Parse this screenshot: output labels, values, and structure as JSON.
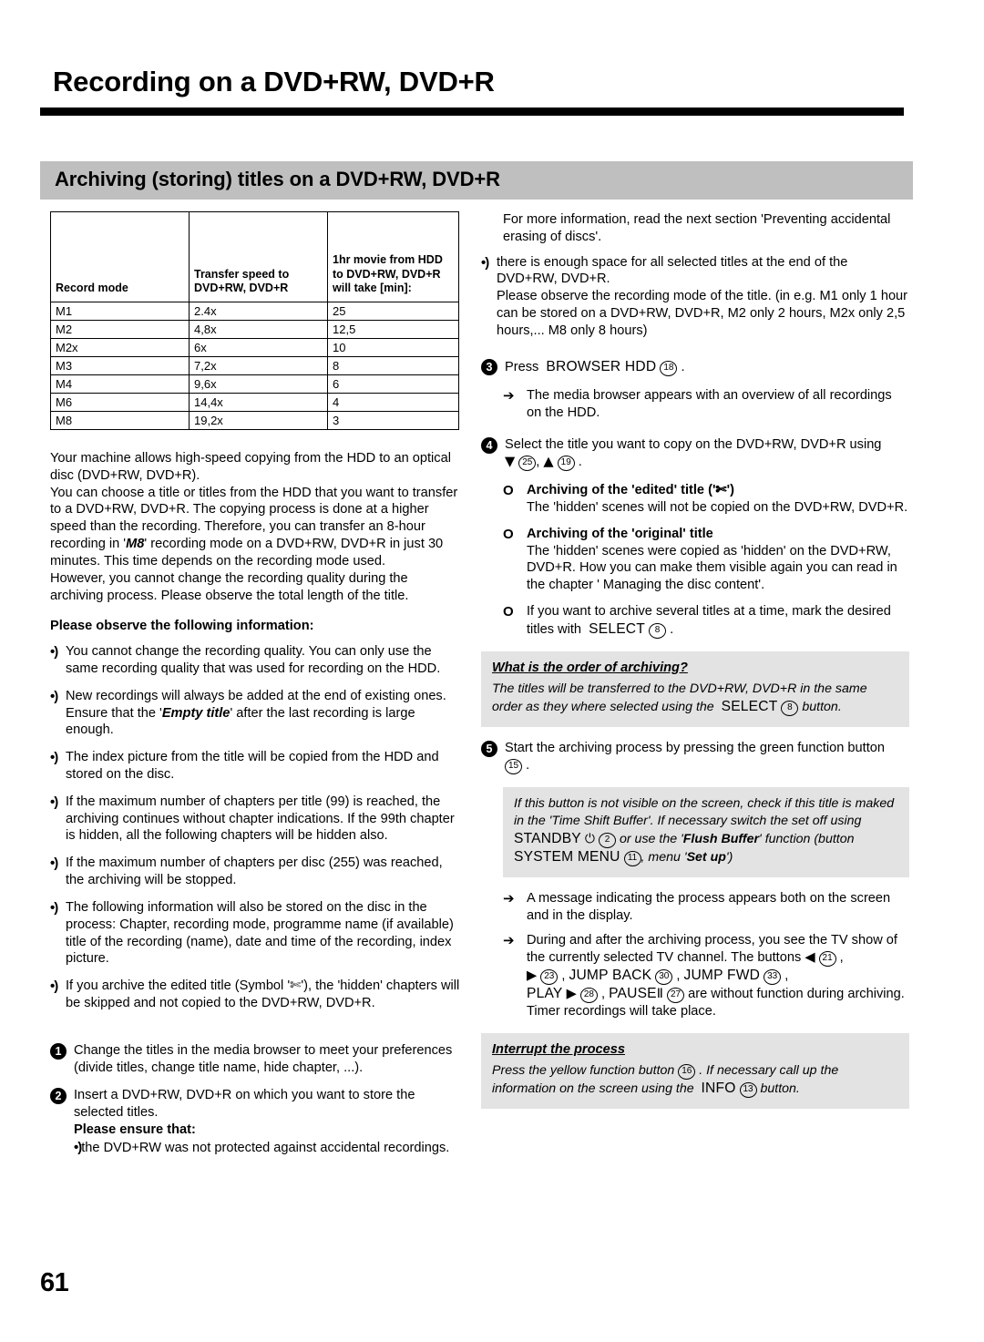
{
  "chapter": {
    "title": "Recording on a DVD+RW, DVD+R"
  },
  "section": {
    "title": "Archiving (storing) titles on a DVD+RW, DVD+R"
  },
  "table": {
    "headers": [
      "Record mode",
      "Transfer speed to DVD+RW, DVD+R",
      "1hr movie from HDD to DVD+RW, DVD+R will take [min]:"
    ],
    "rows": [
      [
        "M1",
        "2.4x",
        "25"
      ],
      [
        "M2",
        "4,8x",
        "12,5"
      ],
      [
        "M2x",
        "6x",
        "10"
      ],
      [
        "M3",
        "7,2x",
        "8"
      ],
      [
        "M4",
        "9,6x",
        "6"
      ],
      [
        "M6",
        "14,4x",
        "4"
      ],
      [
        "M8",
        "19,2x",
        "3"
      ]
    ]
  },
  "left_column": {
    "intro_p1": "Your machine allows high-speed copying from the HDD to an optical disc (DVD+RW, DVD+R).",
    "intro_p2_a": "You can choose a title or titles from the HDD that you want to transfer to a DVD+RW, DVD+R. The copying process is done at a higher speed than the recording. Therefore, you can transfer an 8-hour recording in '",
    "intro_p2_em": "M8",
    "intro_p2_b": "' recording mode on a DVD+RW, DVD+R in just 30 minutes. This time depends on the recording mode used.",
    "intro_p3": "However, you cannot change the recording quality during the archiving process. Please observe the total length of the title.",
    "observe_heading": "Please observe the following information:",
    "bullet_mark": "•)",
    "bullets": [
      {
        "text_a": "You cannot change the recording quality. You can only use the same recording quality that was used for recording on the HDD.",
        "em": "",
        "text_b": ""
      },
      {
        "text_a": "New recordings will always be added at the end of existing ones. Ensure that the '",
        "em": "Empty title",
        "text_b": "' after the last recording is large enough."
      },
      {
        "text_a": "The index picture from the title will be copied from the HDD and stored on the disc.",
        "em": "",
        "text_b": ""
      },
      {
        "text_a": "If the maximum number of chapters per title (99) is reached, the archiving continues without chapter indications. If the 99th chapter is hidden, all the following chapters will be hidden also.",
        "em": "",
        "text_b": ""
      },
      {
        "text_a": "If the maximum number of chapters per disc (255) was reached, the archiving will be stopped.",
        "em": "",
        "text_b": ""
      },
      {
        "text_a": "The following information will also be stored on the disc in the process: Chapter, recording mode, programme name (if available) title of the recording (name), date and time of the recording, index picture.",
        "em": "",
        "text_b": ""
      },
      {
        "text_a": "If you archive the edited title (Symbol '✄'), the 'hidden' chapters will be skipped and not copied to the DVD+RW, DVD+R.",
        "em": "",
        "text_b": ""
      }
    ],
    "step1": {
      "number": "1",
      "text": "Change the titles in the media browser to meet your preferences (divide titles, change title name, hide chapter, ...)."
    },
    "step2": {
      "number": "2",
      "text": "Insert a DVD+RW, DVD+R on which you want to store the selected titles.",
      "ensure_heading": "Please ensure that:",
      "ensure_bullet": "the DVD+RW was not protected against accidental recordings."
    }
  },
  "right_column": {
    "bullet_mark": "•)",
    "arrow_mark": "➔",
    "o_mark": "O",
    "intro": "For more information, read the next section 'Preventing accidental erasing of discs'.",
    "space_bullet": {
      "line1": "there is enough space for all selected titles at the end of the DVD+RW, DVD+R.",
      "line2": "Please observe the recording mode of the title. (in e.g. M1 only 1 hour can be stored on a DVD+RW, DVD+R, M2 only 2 hours, M2x only 2,5 hours,... M8 only 8 hours)"
    },
    "step3": {
      "number": "3",
      "press_label": "Press",
      "key": "BROWSER HDD",
      "key_ref": "18",
      "period": ".",
      "result": "The media browser appears with an overview of all recordings on the HDD."
    },
    "step4": {
      "number": "4",
      "text_line1": "Select the title you want to copy on the DVD+RW, DVD+R using",
      "down_glyph": "▼",
      "down_ref": "25",
      "comma": ",",
      "up_glyph": "▲",
      "up_ref": "19",
      "period": ".",
      "edited": {
        "heading": "Archiving of the 'edited' title ('✄')",
        "body": "The 'hidden' scenes will not be copied on the DVD+RW, DVD+R."
      },
      "original": {
        "heading": "Archiving of the 'original' title",
        "body": "The 'hidden' scenes were copied as 'hidden' on the DVD+RW, DVD+R. How you can make them visible again you can read in the chapter ' Managing the disc content'."
      },
      "several": {
        "text_a": "If you want to archive several titles at a time, mark the desired titles with",
        "key": "SELECT",
        "key_ref": "8",
        "text_b": "."
      }
    },
    "order_box": {
      "title": "What is the order of archiving?",
      "text_a": "The titles will be transferred to the DVD+RW, DVD+R in the same order as they where selected using the",
      "key": "SELECT",
      "key_ref": "8",
      "text_b": "button."
    },
    "step5": {
      "number": "5",
      "text": "Start the archiving process by pressing the green function button",
      "key_ref": "15",
      "period": "."
    },
    "flush_box": {
      "text_a": "If this button is not visible on the screen, check if this title is maked in the 'Time Shift Buffer'. If necessary switch the set off using",
      "standby_key": "STANDBY",
      "standby_glyph": "⏻",
      "standby_ref": "2",
      "text_b": "or use the '",
      "flush_em": "Flush Buffer",
      "text_c": "' function (button",
      "sysmenu_key": "SYSTEM MENU",
      "sysmenu_ref": "11",
      "text_d": ", menu '",
      "setup_em": "Set up",
      "text_e": "')"
    },
    "result_message": "A message indicating the process appears both on the screen and in the display.",
    "result_during": {
      "text_a": "During and after the archiving process, you see the TV show of the currently selected TV channel. The buttons",
      "left_glyph": "◀",
      "left_ref": "21",
      "right_glyph": "▶",
      "right_ref": "23",
      "jump_back": "JUMP BACK",
      "jump_back_ref": "30",
      "jump_fwd": "JUMP FWD",
      "jump_fwd_ref": "33",
      "play": "PLAY",
      "play_glyph": "▶",
      "play_ref": "28",
      "pause": "PAUSE",
      "pause_glyph": "Ⅱ",
      "pause_ref": "27",
      "text_b": "are without function during archiving. Timer recordings will take place."
    },
    "interrupt_box": {
      "title": "Interrupt the process",
      "text_a": "Press the yellow function button",
      "yellow_ref": "16",
      "text_b": ". If necessary call up the information on the screen using the",
      "info_key": "INFO",
      "info_ref": "13",
      "text_c": "button."
    }
  },
  "page_number": "61"
}
